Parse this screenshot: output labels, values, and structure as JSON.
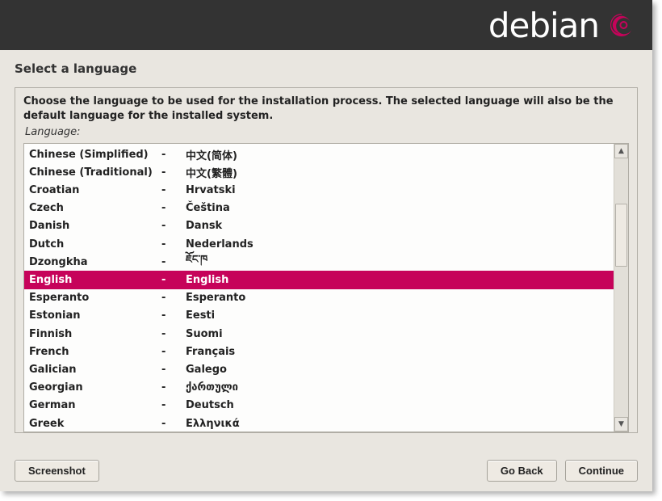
{
  "header": {
    "brand": "debian"
  },
  "title": "Select a language",
  "instruction": "Choose the language to be used for the installation process. The selected language will also be the default language for the installed system.",
  "field_label": "Language:",
  "selected_index": 7,
  "languages": [
    {
      "name": "Chinese (Simplified)",
      "native": "中文(简体)"
    },
    {
      "name": "Chinese (Traditional)",
      "native": "中文(繁體)"
    },
    {
      "name": "Croatian",
      "native": "Hrvatski"
    },
    {
      "name": "Czech",
      "native": "Čeština"
    },
    {
      "name": "Danish",
      "native": "Dansk"
    },
    {
      "name": "Dutch",
      "native": "Nederlands"
    },
    {
      "name": "Dzongkha",
      "native": "ཇོང་ཁ"
    },
    {
      "name": "English",
      "native": "English"
    },
    {
      "name": "Esperanto",
      "native": "Esperanto"
    },
    {
      "name": "Estonian",
      "native": "Eesti"
    },
    {
      "name": "Finnish",
      "native": "Suomi"
    },
    {
      "name": "French",
      "native": "Français"
    },
    {
      "name": "Galician",
      "native": "Galego"
    },
    {
      "name": "Georgian",
      "native": "ქართული"
    },
    {
      "name": "German",
      "native": "Deutsch"
    },
    {
      "name": "Greek",
      "native": "Ελληνικά"
    }
  ],
  "buttons": {
    "screenshot": "Screenshot",
    "go_back": "Go Back",
    "continue": "Continue"
  }
}
